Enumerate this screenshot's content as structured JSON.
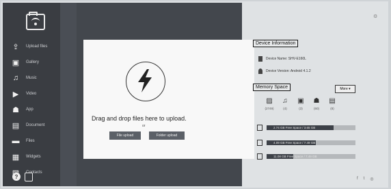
{
  "sidebar": {
    "logo": "folder-wifi-icon",
    "items": [
      {
        "label": "Upload files",
        "icon": "upload-icon"
      },
      {
        "label": "Gallery",
        "icon": "image-icon"
      },
      {
        "label": "Music",
        "icon": "music-icon"
      },
      {
        "label": "Video",
        "icon": "video-icon"
      },
      {
        "label": "App",
        "icon": "android-icon"
      },
      {
        "label": "Document",
        "icon": "document-icon"
      },
      {
        "label": "Files",
        "icon": "folder-icon"
      },
      {
        "label": "Widgets",
        "icon": "widgets-icon"
      },
      {
        "label": "Contacts",
        "icon": "contacts-icon"
      }
    ],
    "bottom": {
      "help": "?"
    }
  },
  "upload": {
    "drop_text": "Drag and drop files here to upload.",
    "or_text": "or",
    "file_button": "File upload",
    "folder_button": "Folder upload"
  },
  "device": {
    "title": "Device Information",
    "name": "Device Name: SHV-E160L",
    "version": "Device Version: Android 4.1.2"
  },
  "memory": {
    "title": "Memory Space",
    "more_label": "More",
    "categories": [
      {
        "icon": "image-icon",
        "count": "(2749)"
      },
      {
        "icon": "music-icon",
        "count": "(4)"
      },
      {
        "icon": "video-icon",
        "count": "(3)"
      },
      {
        "icon": "android-icon",
        "count": "(60)"
      },
      {
        "icon": "document-icon",
        "count": "(8)"
      }
    ],
    "bars": [
      {
        "text": "2.74 GB Free Space / 3.65 GB",
        "fill": 0.75
      },
      {
        "text": "4.09 GB Free Space / 7.49 GB",
        "fill": 0.55
      },
      {
        "text": "11.08 GB Free Space / 7.49 GB",
        "fill": 0.3
      }
    ]
  },
  "colors": {
    "sidebar": "#3a3d42",
    "panel": "#f8f8f8",
    "button": "#5b6067"
  }
}
